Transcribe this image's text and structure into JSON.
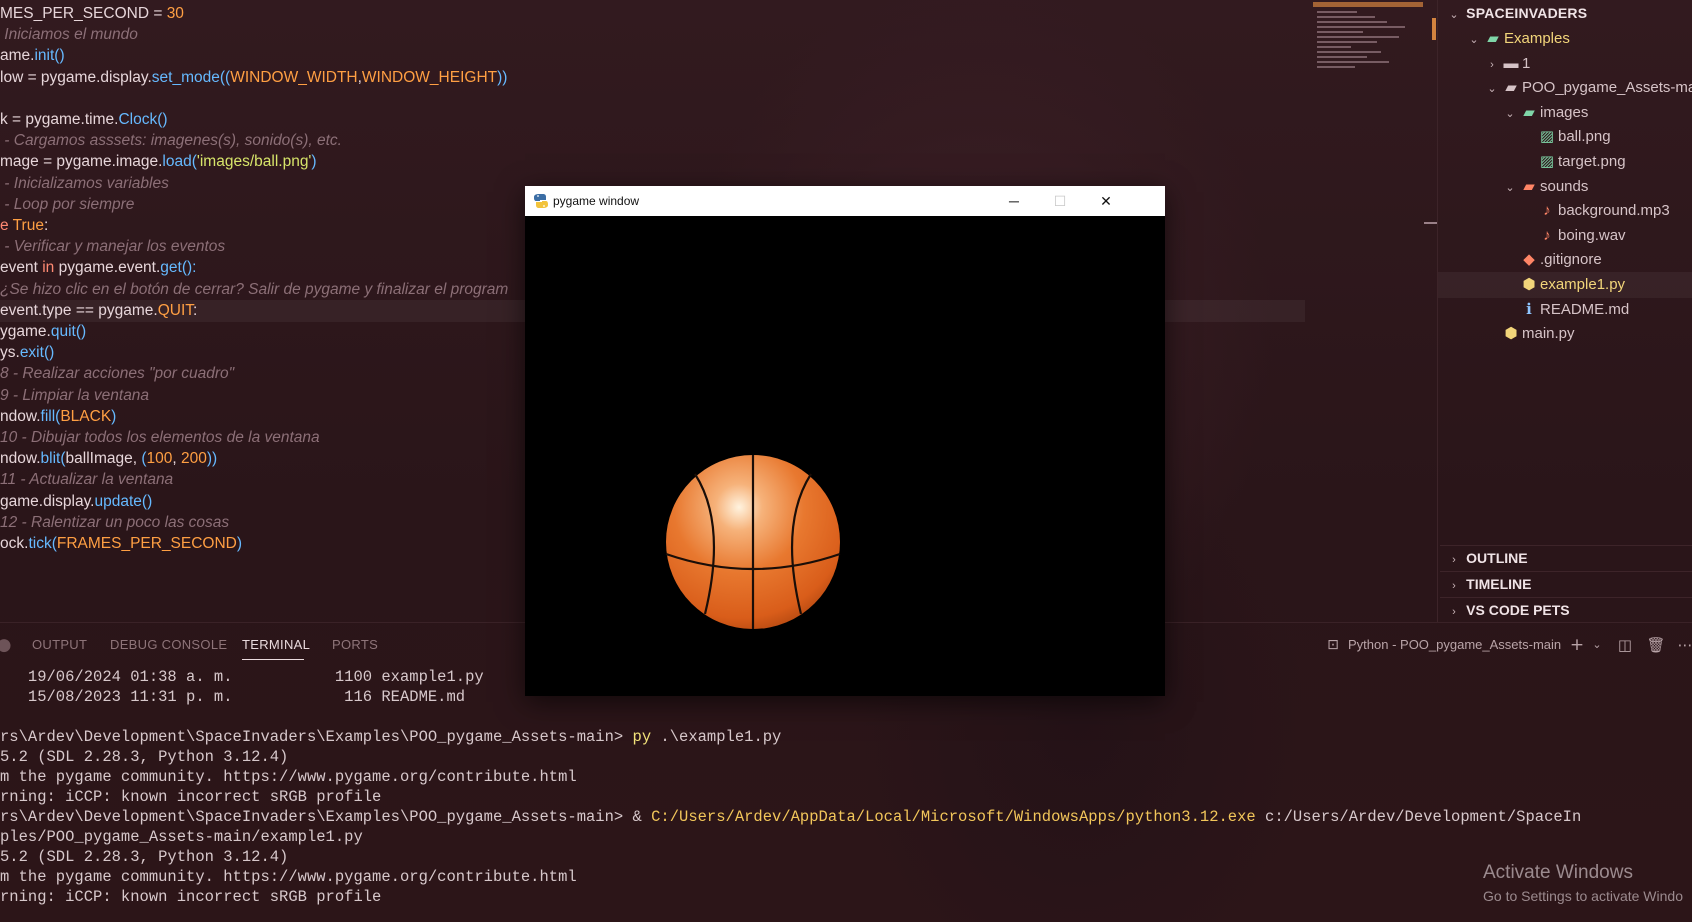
{
  "editor": {
    "code_lines": [
      {
        "tokens": [
          {
            "t": "MES_PER_SECOND = ",
            "c": "text"
          },
          {
            "t": "30",
            "c": "const"
          }
        ]
      },
      {
        "tokens": [
          {
            "t": " Iniciamos el mundo",
            "c": "comment"
          }
        ]
      },
      {
        "tokens": [
          {
            "t": "ame.",
            "c": "text"
          },
          {
            "t": "init",
            "c": "fn"
          },
          {
            "t": "()",
            "c": "fn"
          }
        ]
      },
      {
        "tokens": [
          {
            "t": "low = pygame.display.",
            "c": "text"
          },
          {
            "t": "set_mode",
            "c": "fn"
          },
          {
            "t": "((",
            "c": "fn"
          },
          {
            "t": "WINDOW_WIDTH",
            "c": "const"
          },
          {
            "t": ",",
            "c": "text"
          },
          {
            "t": "WINDOW_HEIGHT",
            "c": "const"
          },
          {
            "t": "))",
            "c": "fn"
          }
        ]
      },
      {
        "tokens": []
      },
      {
        "tokens": [
          {
            "t": "k = pygame.time.",
            "c": "text"
          },
          {
            "t": "Clock",
            "c": "fn"
          },
          {
            "t": "()",
            "c": "fn"
          }
        ]
      },
      {
        "tokens": [
          {
            "t": " - Cargamos asssets: imagenes(s), sonido(s), etc.",
            "c": "comment"
          }
        ]
      },
      {
        "tokens": [
          {
            "t": "mage = pygame.image.",
            "c": "text"
          },
          {
            "t": "load",
            "c": "fn"
          },
          {
            "t": "(",
            "c": "fn"
          },
          {
            "t": "'images/ball.png'",
            "c": "str"
          },
          {
            "t": ")",
            "c": "fn"
          }
        ]
      },
      {
        "tokens": [
          {
            "t": " - Inicializamos variables",
            "c": "comment"
          }
        ]
      },
      {
        "tokens": [
          {
            "t": " - Loop por siempre",
            "c": "comment"
          }
        ]
      },
      {
        "tokens": [
          {
            "t": "e ",
            "c": "kw"
          },
          {
            "t": "True",
            "c": "const"
          },
          {
            "t": ":",
            "c": "text"
          }
        ]
      },
      {
        "tokens": [
          {
            "t": " - Verificar y manejar los eventos",
            "c": "comment"
          }
        ]
      },
      {
        "tokens": [
          {
            "t": "event ",
            "c": "text"
          },
          {
            "t": "in",
            "c": "kw"
          },
          {
            "t": " pygame.event.",
            "c": "text"
          },
          {
            "t": "get",
            "c": "fn"
          },
          {
            "t": "():",
            "c": "fn"
          }
        ]
      },
      {
        "tokens": [
          {
            "t": "¿Se hizo clic en el botón de cerrar? Salir de pygame y finalizar el program",
            "c": "comment"
          }
        ]
      },
      {
        "tokens": [
          {
            "t": "event.type == pygame.",
            "c": "text"
          },
          {
            "t": "QUIT",
            "c": "const"
          },
          {
            "t": ":",
            "c": "text"
          }
        ]
      },
      {
        "tokens": [
          {
            "t": "ygame.",
            "c": "text"
          },
          {
            "t": "quit",
            "c": "fn"
          },
          {
            "t": "()",
            "c": "fn"
          }
        ]
      },
      {
        "tokens": [
          {
            "t": "ys.",
            "c": "text"
          },
          {
            "t": "exit",
            "c": "fn"
          },
          {
            "t": "()",
            "c": "fn"
          }
        ]
      },
      {
        "tokens": [
          {
            "t": "8 - Realizar acciones \"por cuadro\"",
            "c": "comment"
          }
        ]
      },
      {
        "tokens": [
          {
            "t": "9 - Limpiar la ventana",
            "c": "comment"
          }
        ]
      },
      {
        "tokens": [
          {
            "t": "ndow.",
            "c": "text"
          },
          {
            "t": "fill",
            "c": "fn"
          },
          {
            "t": "(",
            "c": "fn"
          },
          {
            "t": "BLACK",
            "c": "const"
          },
          {
            "t": ")",
            "c": "fn"
          }
        ]
      },
      {
        "tokens": [
          {
            "t": "10 - Dibujar todos los elementos de la ventana",
            "c": "comment"
          }
        ]
      },
      {
        "tokens": [
          {
            "t": "ndow.",
            "c": "text"
          },
          {
            "t": "blit",
            "c": "fn"
          },
          {
            "t": "(",
            "c": "fn"
          },
          {
            "t": "ballImage, ",
            "c": "text"
          },
          {
            "t": "(",
            "c": "fn"
          },
          {
            "t": "100",
            "c": "const"
          },
          {
            "t": ", ",
            "c": "text"
          },
          {
            "t": "200",
            "c": "const"
          },
          {
            "t": "))",
            "c": "fn"
          }
        ]
      },
      {
        "tokens": [
          {
            "t": "11 - Actualizar la ventana",
            "c": "comment"
          }
        ]
      },
      {
        "tokens": [
          {
            "t": "game.display.",
            "c": "text"
          },
          {
            "t": "update",
            "c": "fn"
          },
          {
            "t": "()",
            "c": "fn"
          }
        ]
      },
      {
        "tokens": [
          {
            "t": "12 - Ralentizar un poco las cosas",
            "c": "comment"
          }
        ]
      },
      {
        "tokens": [
          {
            "t": "ock.",
            "c": "text"
          },
          {
            "t": "tick",
            "c": "fn"
          },
          {
            "t": "(",
            "c": "fn"
          },
          {
            "t": "FRAMES_PER_SECOND",
            "c": "const"
          },
          {
            "t": ")",
            "c": "fn"
          }
        ]
      }
    ]
  },
  "explorer": {
    "root": "SPACEINVADERS",
    "tree": [
      {
        "label": "Examples",
        "indent": 1,
        "chevron": "open",
        "icon": "folder-open-icon",
        "glyph": "▰",
        "color": "green"
      },
      {
        "label": "1",
        "indent": 2,
        "chevron": "closed",
        "icon": "folder-icon",
        "glyph": "▬",
        "color": "plain"
      },
      {
        "label": "POO_pygame_Assets-main",
        "indent": 2,
        "chevron": "open",
        "icon": "folder-open-icon",
        "glyph": "▰",
        "color": "plain"
      },
      {
        "label": "images",
        "indent": 3,
        "chevron": "open",
        "icon": "images-folder-icon",
        "glyph": "▰",
        "color": "green"
      },
      {
        "label": "ball.png",
        "indent": 4,
        "chevron": "none",
        "icon": "image-file-icon",
        "glyph": "▨",
        "color": "green"
      },
      {
        "label": "target.png",
        "indent": 4,
        "chevron": "none",
        "icon": "image-file-icon",
        "glyph": "▨",
        "color": "green"
      },
      {
        "label": "sounds",
        "indent": 3,
        "chevron": "open",
        "icon": "sounds-folder-icon",
        "glyph": "▰",
        "color": "red"
      },
      {
        "label": "background.mp3",
        "indent": 4,
        "chevron": "none",
        "icon": "audio-file-icon",
        "glyph": "♪",
        "color": "red"
      },
      {
        "label": "boing.wav",
        "indent": 4,
        "chevron": "none",
        "icon": "audio-file-icon",
        "glyph": "♪",
        "color": "red"
      },
      {
        "label": ".gitignore",
        "indent": 3,
        "chevron": "none",
        "icon": "git-icon",
        "glyph": "◆",
        "color": "red"
      },
      {
        "label": "example1.py",
        "indent": 3,
        "chevron": "none",
        "icon": "python-file-icon",
        "glyph": "⬢",
        "color": "yellow",
        "selected": true
      },
      {
        "label": "README.md",
        "indent": 3,
        "chevron": "none",
        "icon": "info-icon",
        "glyph": "ℹ",
        "color": "blue"
      },
      {
        "label": "main.py",
        "indent": 2,
        "chevron": "none",
        "icon": "python-file-icon",
        "glyph": "⬢",
        "color": "yellow"
      }
    ],
    "sections": [
      "OUTLINE",
      "TIMELINE",
      "VS CODE PETS"
    ]
  },
  "panel": {
    "tabs": [
      "OUTPUT",
      "DEBUG CONSOLE",
      "TERMINAL",
      "PORTS"
    ],
    "active_tab": "TERMINAL",
    "terminal_name": "Python - POO_pygame_Assets-main",
    "terminal_lines": [
      [
        {
          "t": "   19/06/2024 01:38 a. m.           1100 example1.py",
          "c": "plain"
        }
      ],
      [
        {
          "t": "   15/08/2023 11:31 p. m.            116 README.md",
          "c": "plain"
        }
      ],
      [],
      [
        {
          "t": "rs\\Ardev\\Development\\SpaceInvaders\\Examples\\POO_pygame_Assets-main> ",
          "c": "plain"
        },
        {
          "t": "py",
          "c": "cmd"
        },
        {
          "t": " .\\example1.py",
          "c": "plain"
        }
      ],
      [
        {
          "t": "5.2 (SDL 2.28.3, Python 3.12.4)",
          "c": "plain"
        }
      ],
      [
        {
          "t": "m the pygame community. https://www.pygame.org/contribute.html",
          "c": "plain"
        }
      ],
      [
        {
          "t": "rning: iCCP: known incorrect sRGB profile",
          "c": "plain"
        }
      ],
      [
        {
          "t": "rs\\Ardev\\Development\\SpaceInvaders\\Examples\\POO_pygame_Assets-main> & ",
          "c": "plain"
        },
        {
          "t": "C:/Users/Ardev/AppData/Local/Microsoft/WindowsApps/python3.12.exe",
          "c": "path"
        },
        {
          "t": " c:/Users/Ardev/Development/SpaceIn",
          "c": "plain"
        }
      ],
      [
        {
          "t": "ples/POO_pygame_Assets-main/example1.py",
          "c": "plain"
        }
      ],
      [
        {
          "t": "5.2 (SDL 2.28.3, Python 3.12.4)",
          "c": "plain"
        }
      ],
      [
        {
          "t": "m the pygame community. https://www.pygame.org/contribute.html",
          "c": "plain"
        }
      ],
      [
        {
          "t": "rning: iCCP: known incorrect sRGB profile",
          "c": "plain"
        }
      ]
    ]
  },
  "pygame_window": {
    "title": "pygame window",
    "minimize": "─",
    "maximize": "☐",
    "close": "✕"
  },
  "watermark": {
    "title": "Activate Windows",
    "subtitle": "Go to Settings to activate Windo"
  },
  "colors": {
    "background": "#2b1519",
    "code_text": "#e7d6da",
    "function": "#66b9ff",
    "constant": "#ff9f43",
    "string": "#d7e46a",
    "keyword": "#ff8a73",
    "comment": "#8c6f77",
    "selected_file": "#f2d57a"
  }
}
